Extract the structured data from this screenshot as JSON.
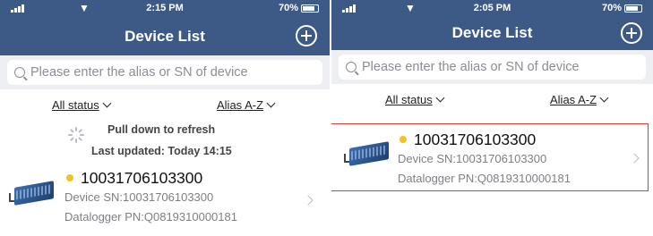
{
  "screens": [
    {
      "status_bar": {
        "time": "2:15 PM",
        "battery": "70%"
      },
      "header": {
        "title": "Device List"
      },
      "search": {
        "placeholder": "Please enter the alias or SN of device"
      },
      "filters": {
        "status": "All status",
        "sort": "Alias A-Z"
      },
      "refresh": {
        "pull_text": "Pull down to refresh",
        "last_updated": "Last updated: Today 14:15"
      },
      "devices": [
        {
          "alias": "10031706103300",
          "sn": "Device SN:10031706103300",
          "pn": "Datalogger PN:Q0819310000181",
          "status_color": "#f2c128"
        }
      ]
    },
    {
      "status_bar": {
        "time": "2:05 PM",
        "battery": "70%"
      },
      "header": {
        "title": "Device List"
      },
      "search": {
        "placeholder": "Please enter the alias or SN of device"
      },
      "filters": {
        "status": "All status",
        "sort": "Alias A-Z"
      },
      "devices": [
        {
          "alias": "10031706103300",
          "sn": "Device SN:10031706103300",
          "pn": "Datalogger PN:Q0819310000181",
          "status_color": "#f2c128"
        }
      ]
    }
  ],
  "colors": {
    "header": "#3d5a86",
    "highlight_border": "#e03c3c",
    "status_dot": "#f2c128"
  },
  "icons": [
    "signal-icon",
    "wifi-icon",
    "battery-icon",
    "add-icon",
    "search-icon",
    "chevron-down-icon",
    "spinner-icon",
    "inverter-device-icon",
    "chevron-right-icon"
  ]
}
